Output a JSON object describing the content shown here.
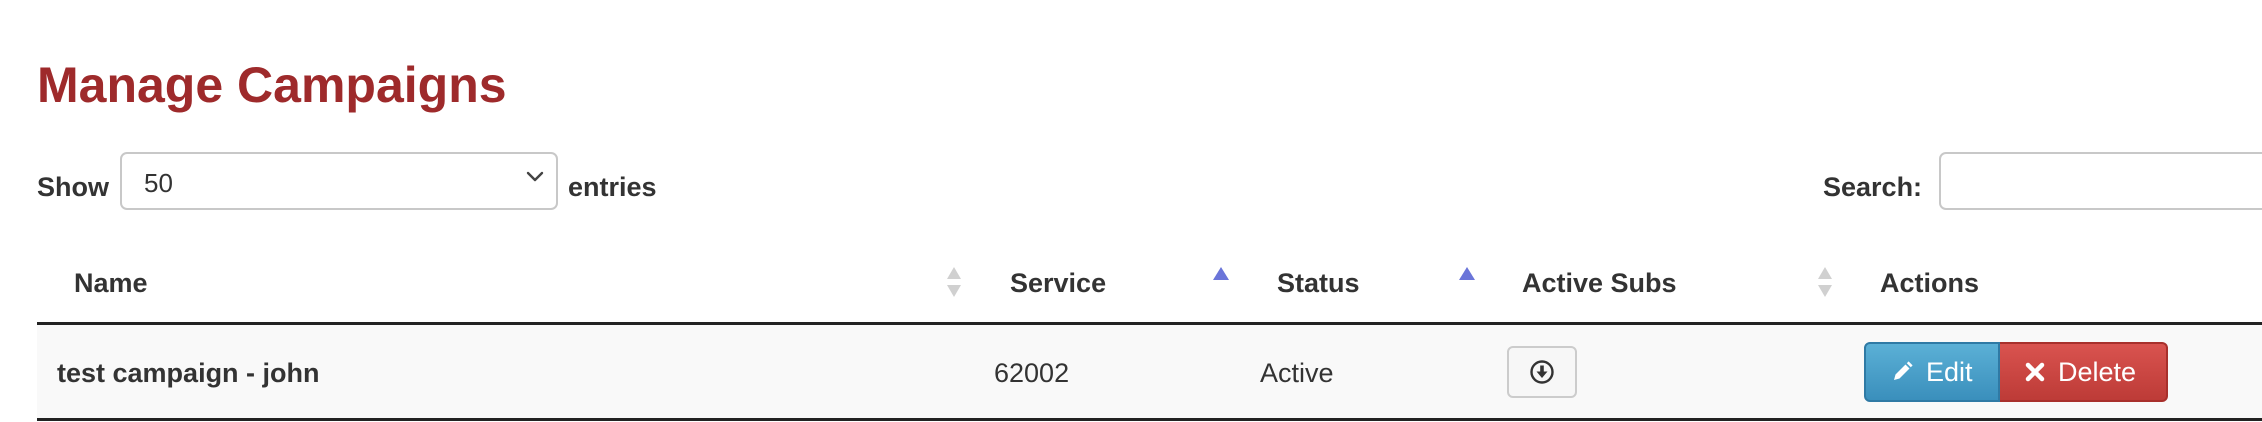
{
  "page": {
    "title": "Manage Campaigns"
  },
  "length_control": {
    "show_label": "Show",
    "selected": "50",
    "entries_label": "entries"
  },
  "search": {
    "label": "Search:",
    "value": ""
  },
  "table": {
    "columns": [
      {
        "label": "Name",
        "sort": "unsorted"
      },
      {
        "label": "Service",
        "sort": "ascending"
      },
      {
        "label": "Status",
        "sort": "ascending"
      },
      {
        "label": "Active Subs",
        "sort": "unsorted"
      },
      {
        "label": "Actions",
        "sort": "none"
      }
    ],
    "rows": [
      {
        "name": "test campaign - john",
        "service": "62002",
        "status": "Active",
        "active_subs_icon": "download-circle-icon",
        "actions": {
          "edit_label": "Edit",
          "delete_label": "Delete"
        }
      }
    ]
  },
  "colors": {
    "title": "#9e2a2b",
    "edit_button": "#3a8fbc",
    "delete_button": "#bd3b37",
    "sort_active": "#6b75d9",
    "sort_inactive": "#d0d0d0"
  }
}
